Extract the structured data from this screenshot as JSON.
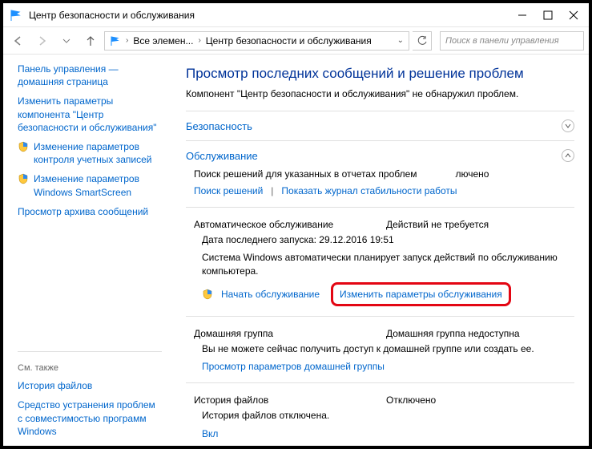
{
  "window": {
    "title": "Центр безопасности и обслуживания"
  },
  "breadcrumb": {
    "root": "Все элемен...",
    "current": "Центр безопасности и обслуживания"
  },
  "search": {
    "placeholder": "Поиск в панели управления"
  },
  "sidebar": {
    "home": "Панель управления — домашняя страница",
    "items": [
      {
        "label": "Изменить параметры компонента \"Центр безопасности и обслуживания\"",
        "shield": false
      },
      {
        "label": "Изменение параметров контроля учетных записей",
        "shield": true
      },
      {
        "label": "Изменение параметров Windows SmartScreen",
        "shield": true
      },
      {
        "label": "Просмотр архива сообщений",
        "shield": false
      }
    ],
    "seealso_label": "См. также",
    "seealso": [
      "История файлов",
      "Средство устранения проблем с совместимостью программ Windows"
    ]
  },
  "content": {
    "heading": "Просмотр последних сообщений и решение проблем",
    "subtitle": "Компонент \"Центр безопасности и обслуживания\" не обнаружил проблем.",
    "security_title": "Безопасность",
    "maintenance_title": "Обслуживание",
    "problem_reports": {
      "label": "Поиск решений для указанных в отчетах проблем",
      "status": "лючено",
      "link1": "Поиск решений",
      "link2": "Показать журнал стабильности работы"
    },
    "automaint": {
      "label": "Автоматическое обслуживание",
      "status": "Действий не требуется",
      "date_label": "Дата последнего запуска: 29.12.2016 19:51",
      "desc": "Система Windows автоматически планирует запуск действий по обслуживанию компьютера.",
      "start_link": "Начать обслуживание",
      "change_link": "Изменить параметры обслуживания"
    },
    "homegroup": {
      "label": "Домашняя группа",
      "status": "Домашняя группа недоступна",
      "desc": "Вы не можете сейчас получить доступ к домашней группе или создать ее.",
      "link": "Просмотр параметров домашней группы"
    },
    "filehistory": {
      "label": "История файлов",
      "status": "Отключено",
      "desc": "История файлов отключена.",
      "link_partial": "Вкл"
    }
  }
}
